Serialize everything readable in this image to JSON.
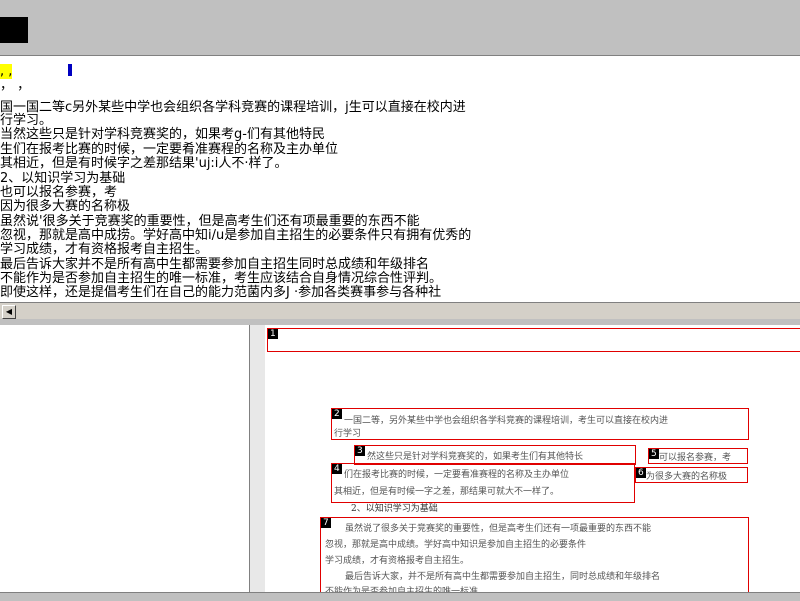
{
  "ocr": {
    "lines": [
      {
        "t": "    ,  ,  ",
        "cls": "hl"
      },
      {
        "t": "  ，  ， ",
        "cls": "red"
      },
      {
        "t": "国一国二等c另外某些中学也会组织各学科竞赛的课程培训，j生可以直接在校内进"
      },
      {
        "t": "行学习。"
      },
      {
        "t": "当然这些只是针对学科竞赛奖的，如果考g-们有其他特民"
      },
      {
        "t": "生们在报考比赛的时候，一定要肴准赛程的名称及主办单位"
      },
      {
        "t": "其相近，但是有时候字之差那结果'uj:i人不·样了。"
      },
      {
        "t": "   2、以知识学习为基础"
      },
      {
        "t": "也可以报名参赛，考"
      },
      {
        "t": "因为很多大赛的名称极"
      },
      {
        "t": "    虽然说'很多关于竞赛奖的重要性，但是高考生们还有项最重要的东西不能"
      },
      {
        "t": "忽视，那就是高中成捞。学好高中知i/u是参加自主招生的必要条件只有拥有优秀的"
      },
      {
        "t": "学习成绩，才有资格报考自主招生。"
      },
      {
        "t": "    最后告诉大家并不是所有高中生都需要参加自主招生同时总成绩和年级排名"
      },
      {
        "t": "不能作为是否参加自主招生的唯一标准，考生应该结合自身情况综合性评判。"
      },
      {
        "t": "    即使这样，还是提倡考生们在自己的能力范菌内多J ·参加各类赛事参与各种社"
      }
    ]
  },
  "scan": {
    "boxes": [
      {
        "num": "1",
        "text": ""
      },
      {
        "num": "2",
        "text": "一国二等，另外某些中学也会组织各学科竞赛的课程培训，考生可以直接在校内进"
      },
      {
        "num": "3",
        "text": "然这些只是针对学科竞赛奖的，如果考生们有其他特长"
      },
      {
        "num": "4",
        "text": "们在报考比赛的时候，一定要看准赛程的名称及主办单位"
      },
      {
        "num": "5",
        "text": "可以报名参赛，考"
      },
      {
        "num": "6",
        "text": "为很多大赛的名称极"
      },
      {
        "num": "7",
        "text": "虽然说了很多关于竞赛奖的重要性，但是高考生们还有一项最重要的东西不能"
      }
    ],
    "extra": [
      "行学习",
      "其相近，但是有时候一字之差，那结果可就大不一样了。",
      "2、以知识学习为基础",
      "忽视，那就是高中成绩。学好高中知识是参加自主招生的必要条件",
      "学习成绩，才有资格报考自主招生。",
      "最后告诉大家，并不是所有高中生都需要参加自主招生，同时总成绩和年级排名",
      "不能作为是否参加自主招生的唯一标准"
    ]
  }
}
